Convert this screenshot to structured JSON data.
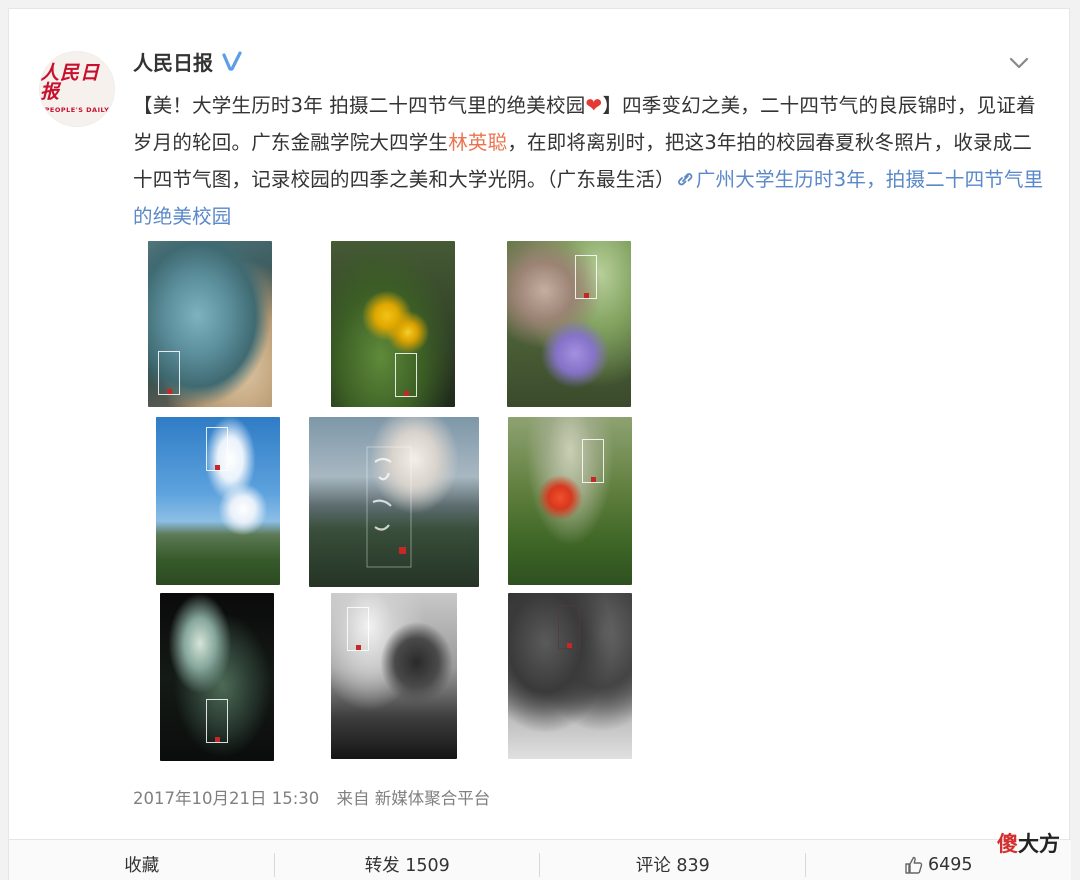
{
  "post": {
    "author": "人民日报",
    "avatar": {
      "logo_cn": "人民日报",
      "logo_en": "PEOPLE'S DAILY"
    },
    "text": {
      "part1": "【美！大学生历时3年 拍摄二十四节气里的绝美校园",
      "heart": "❤",
      "part2": "】四季变幻之美，二十四节气的良辰锦时，见证着岁月的轮回。广东金融学院大四学生",
      "mention": "林英聪",
      "part3": "，在即将离别时，把这3年拍的校园春夏秋冬照片，收录成二十四节气图，记录校园的四季之美和大学光阴。（广东最生活）",
      "link": "广州大学生历时3年，拍摄二十四节气里的绝美校园"
    },
    "timestamp": "2017年10月21日 15:30",
    "source_prefix": "来自",
    "source": "新媒体聚合平台"
  },
  "actions": {
    "favorite": "收藏",
    "repost": "转发 1509",
    "comment": "评论 839",
    "like": "6495"
  },
  "watermark": {
    "part1": "傻",
    "part2": "大方"
  },
  "photos": [
    {
      "name": "photo-succulent",
      "icon": "photo"
    },
    {
      "name": "photo-yellow-flowers",
      "icon": "photo"
    },
    {
      "name": "photo-purple-flower",
      "icon": "photo"
    },
    {
      "name": "photo-sky-campus",
      "icon": "photo"
    },
    {
      "name": "photo-four-seasons-cover",
      "icon": "photo"
    },
    {
      "name": "photo-red-flower",
      "icon": "photo"
    },
    {
      "name": "photo-dark-window",
      "icon": "photo"
    },
    {
      "name": "photo-bw-tower",
      "icon": "photo"
    },
    {
      "name": "photo-bw-campus-walk",
      "icon": "photo"
    }
  ],
  "colors": {
    "link": "#5a88c9",
    "mention": "#eb7350",
    "accent_red": "#c8102e",
    "verified": "#5b9ee9"
  }
}
